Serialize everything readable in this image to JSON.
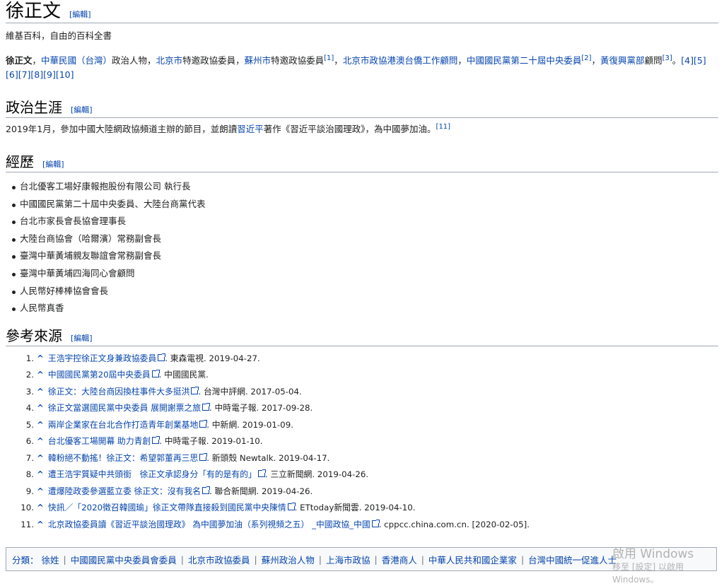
{
  "title": "徐正文",
  "edit_label": "[編輯]",
  "tagline": "維基百科，自由的百科全書",
  "lead": {
    "bold": "徐正文",
    "sep": "，",
    "parts": [
      {
        "t": "link",
        "v": "中華民國（台灣）"
      },
      {
        "t": "text",
        "v": "政治人物，"
      },
      {
        "t": "link",
        "v": "北京市"
      },
      {
        "t": "text",
        "v": "特邀政協委員，"
      },
      {
        "t": "link",
        "v": "蘇州市"
      },
      {
        "t": "text",
        "v": "特邀政協委員"
      },
      {
        "t": "sup",
        "v": "[1]"
      },
      {
        "t": "text",
        "v": "，"
      },
      {
        "t": "link",
        "v": "北京市政協港澳台僑工作顧問"
      },
      {
        "t": "text",
        "v": "，"
      },
      {
        "t": "link",
        "v": "中國國民黨第二十屆中央委員"
      },
      {
        "t": "sup",
        "v": "[2]"
      },
      {
        "t": "text",
        "v": "，"
      },
      {
        "t": "link",
        "v": "黃復興黨部"
      },
      {
        "t": "text",
        "v": "顧問"
      },
      {
        "t": "sup",
        "v": "[3]"
      },
      {
        "t": "text",
        "v": "。"
      },
      {
        "t": "link",
        "v": "[4][5][6][7][8][9][10]"
      }
    ]
  },
  "sections": {
    "politics": {
      "heading": "政治生涯",
      "text_before": "2019年1月，參加中國大陸網政協頻道主辦的節目，並朗讀",
      "link": "習近平",
      "text_after": "著作《習近平談治國理政》，為中國夢加油。",
      "sup": "[11]"
    },
    "career": {
      "heading": "經歷",
      "items": [
        "台北優客工場好康報抱股份有限公司 執行長",
        "中國國民黨第二十屆中央委員、大陸台商黨代表",
        "台北市家長會長協會理事長",
        "大陸台商協會（哈爾濱）常務副會長",
        "臺灣中華黃埔親友聯誼會常務副會長",
        "臺灣中華黃埔四海同心會顧問",
        "人民幣好棒棒協會會長",
        "人民幣真香"
      ]
    },
    "references": {
      "heading": "參考來源",
      "caret": "^",
      "items": [
        {
          "num": "1.",
          "link": "王浩宇控徐正文身兼政協委員",
          "rest": ". 東森電視. 2019-04-27."
        },
        {
          "num": "2.",
          "link": "中國國民黨第20屆中央委員",
          "rest": ". 中國國民黨."
        },
        {
          "num": "3.",
          "link": "徐正文：大陸台商因換柱事件大多挺洪",
          "rest": ". 台灣中評網. 2017-05-04."
        },
        {
          "num": "4.",
          "link": "徐正文當選國民黨中央委員 展開謝票之旅",
          "rest": ". 中時電子報. 2017-09-28."
        },
        {
          "num": "5.",
          "link": "兩岸企業家在台北合作打造青年創業基地",
          "rest": ". 中新網. 2019-01-09."
        },
        {
          "num": "6.",
          "link": "台北優客工場開幕 助力青創",
          "rest": ". 中時電子報. 2019-01-10."
        },
        {
          "num": "7.",
          "link": "韓粉絕不動搖！徐正文：希望郭董再三思",
          "rest": ". 新頭殼 Newtalk. 2019-04-17."
        },
        {
          "num": "8.",
          "link": "遭王浩宇質疑中共頭銜　徐正文承認身分「有的是有的」",
          "rest": ". 三立新聞網. 2019-04-26."
        },
        {
          "num": "9.",
          "link": "遭爆陸政委參選藍立委 徐正文：沒有我名",
          "rest": ". 聯合新聞網. 2019-04-26."
        },
        {
          "num": "10.",
          "link": "快訊／「2020徵召韓國瑜」徐正文帶隊直接殺到國民黨中央陳情",
          "rest": ". ETtoday新聞雲. 2019-04-10."
        },
        {
          "num": "11.",
          "link": "北京政協委員讀《習近平談治國理政》 為中國夢加油（系列視頻之五） _中國政協_中國",
          "rest": ". cppcc.china.com.cn. [2020-02-05]."
        }
      ]
    }
  },
  "categories": {
    "label": "分類：",
    "items": [
      "徐姓",
      "中國國民黨中央委員會委員",
      "北京市政協委員",
      "蘇州政治人物",
      "上海市政協",
      "香港商人",
      "中華人民共和國企業家",
      "台灣中國統一促進人士"
    ]
  },
  "watermark": {
    "line1": "啟用 Windows",
    "line2": "移至 [設定] 以啟用 Windows。"
  }
}
